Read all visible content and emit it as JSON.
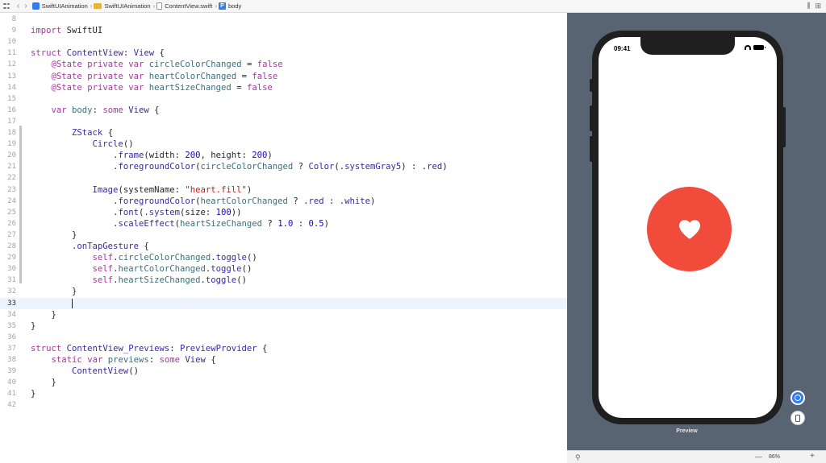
{
  "jumpbar": {
    "crumbs": [
      "SwiftUIAnimation",
      "SwiftUIAnimation",
      "ContentView.swift",
      "body"
    ],
    "prop_badge": "P"
  },
  "editor": {
    "current_line": "33",
    "lines": [
      {
        "n": "8",
        "html": ""
      },
      {
        "n": "9",
        "html": "<span class='kw'>import</span> SwiftUI"
      },
      {
        "n": "10",
        "html": ""
      },
      {
        "n": "11",
        "html": "<span class='kw'>struct</span> <span class='ty'>ContentView</span>: <span class='ty'>View</span> {"
      },
      {
        "n": "12",
        "html": "    <span class='kw'>@State</span> <span class='kw'>private</span> <span class='kw'>var</span> <span class='fn'>circleColorChanged</span> = <span class='kw'>false</span>"
      },
      {
        "n": "13",
        "html": "    <span class='kw'>@State</span> <span class='kw'>private</span> <span class='kw'>var</span> <span class='fn'>heartColorChanged</span> = <span class='kw'>false</span>"
      },
      {
        "n": "14",
        "html": "    <span class='kw'>@State</span> <span class='kw'>private</span> <span class='kw'>var</span> <span class='fn'>heartSizeChanged</span> = <span class='kw'>false</span>"
      },
      {
        "n": "15",
        "html": ""
      },
      {
        "n": "16",
        "html": "    <span class='kw'>var</span> <span class='fn'>body</span>: <span class='kw'>some</span> <span class='ty'>View</span> {"
      },
      {
        "n": "17",
        "html": ""
      },
      {
        "n": "18",
        "html": "        <span class='ty'>ZStack</span> {"
      },
      {
        "n": "19",
        "html": "            <span class='ty'>Circle</span>()"
      },
      {
        "n": "20",
        "html": "                .<span class='ty'>frame</span>(width: <span class='num'>200</span>, height: <span class='num'>200</span>)"
      },
      {
        "n": "21",
        "html": "                .<span class='ty'>foregroundColor</span>(<span class='fn'>circleColorChanged</span> ? <span class='ty'>Color</span>(.<span class='ty'>systemGray5</span>) : .<span class='ty'>red</span>)"
      },
      {
        "n": "22",
        "html": ""
      },
      {
        "n": "23",
        "html": "            <span class='ty'>Image</span>(systemName: <span class='str'>\"heart.fill\"</span>)"
      },
      {
        "n": "24",
        "html": "                .<span class='ty'>foregroundColor</span>(<span class='fn'>heartColorChanged</span> ? .<span class='ty'>red</span> : .<span class='ty'>white</span>)"
      },
      {
        "n": "25",
        "html": "                .<span class='ty'>font</span>(.<span class='ty'>system</span>(size: <span class='num'>100</span>))"
      },
      {
        "n": "26",
        "html": "                .<span class='ty'>scaleEffect</span>(<span class='fn'>heartSizeChanged</span> ? <span class='num'>1.0</span> : <span class='num'>0.5</span>)"
      },
      {
        "n": "27",
        "html": "        }"
      },
      {
        "n": "28",
        "html": "        .<span class='ty'>onTapGesture</span> {"
      },
      {
        "n": "29",
        "html": "            <span class='kw'>self</span>.<span class='fn'>circleColorChanged</span>.<span class='ty'>toggle</span>()"
      },
      {
        "n": "30",
        "html": "            <span class='kw'>self</span>.<span class='fn'>heartColorChanged</span>.<span class='ty'>toggle</span>()"
      },
      {
        "n": "31",
        "html": "            <span class='kw'>self</span>.<span class='fn'>heartSizeChanged</span>.<span class='ty'>toggle</span>()"
      },
      {
        "n": "32",
        "html": "        }"
      },
      {
        "n": "33",
        "html": "        <span class='caret'></span>"
      },
      {
        "n": "34",
        "html": "    }"
      },
      {
        "n": "35",
        "html": "}"
      },
      {
        "n": "36",
        "html": ""
      },
      {
        "n": "37",
        "html": "<span class='kw'>struct</span> <span class='ty'>ContentView_Previews</span>: <span class='ty'>PreviewProvider</span> {"
      },
      {
        "n": "38",
        "html": "    <span class='kw'>static</span> <span class='kw'>var</span> <span class='fn'>previews</span>: <span class='kw'>some</span> <span class='ty'>View</span> {"
      },
      {
        "n": "39",
        "html": "        <span class='ty'>ContentView</span>()"
      },
      {
        "n": "40",
        "html": "    }"
      },
      {
        "n": "41",
        "html": "}"
      },
      {
        "n": "42",
        "html": ""
      }
    ]
  },
  "preview": {
    "status_time": "09:41",
    "label": "Preview",
    "circle_color": "#f04b3b",
    "heart_color": "#ffffff",
    "background": "#596472"
  },
  "canvas_bar": {
    "zoom_level": "86%",
    "zoom_minus": "—",
    "zoom_plus": "+"
  }
}
